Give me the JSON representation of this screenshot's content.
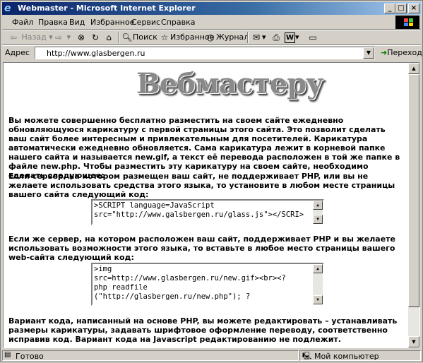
{
  "window": {
    "title": "Webmaster - Microsoft Internet Explorer",
    "min": "_",
    "max": "□",
    "close": "×"
  },
  "menu": [
    "Файл",
    "Правка",
    "Вид",
    "Избранное",
    "Сервис",
    "Справка"
  ],
  "toolbar": {
    "back": "Назад",
    "search": "Поиск",
    "favorites": "Избранное",
    "journal": "Журнал"
  },
  "address": {
    "label": "Адрес",
    "url": "http://www.glasbergen.ru",
    "go": "Переход"
  },
  "page": {
    "logo": "Вебмастеру",
    "intro": "Вы можете совершенно бесплатно разместить на своем сайте ежедневно обновляющуюся карикатуру с первой страницы этого сайта. Это позволит сделать ваш сайт более интересным и привлекательным для посетителей. Карикатура автоматически ежедневно обновляется. Сама карикатура лежит в корневой папке нашего сайта и называется new.gif, а текст её перевода расположен в той же папке в файле new.php. Чтобы разместить эту карикатуру на своем сайте, необходимо сделать следующее:",
    "nophp": "Если сервер, на котором размещен ваш сайт, не поддерживает PHP, или вы не желаете использовать средства этого языка, то установите в любом месте страницы вашего сайта следующий код:",
    "code_js": ">SCRIPT language=JavaScript\nsrc=\"http://www.galsbergen.ru/glass.js\"></SCRI>",
    "php": "Если же сервер, на котором расположен ваш сайт, поддерживает PHP и вы желаете использовать возможности этого языка, то вставьте в любое место страницы вашего web-сайта следующий код:",
    "code_php": ">img\nsrc=http://www.glasbergen.ru/new.gif><br><?\nphp readfile\n(\"http://glasbergen.ru/new.php\"); ?",
    "footer": "Вариант кода, написанный на основе PHP, вы можете редактировать – устанавливать размеры карикатуры, задавать шрифтовое оформление переводу, соответственно исправив код. Вариант кода на Javascript редактированию не подлежит."
  },
  "status": {
    "text": "Готово",
    "zone": "Мой компьютер"
  }
}
